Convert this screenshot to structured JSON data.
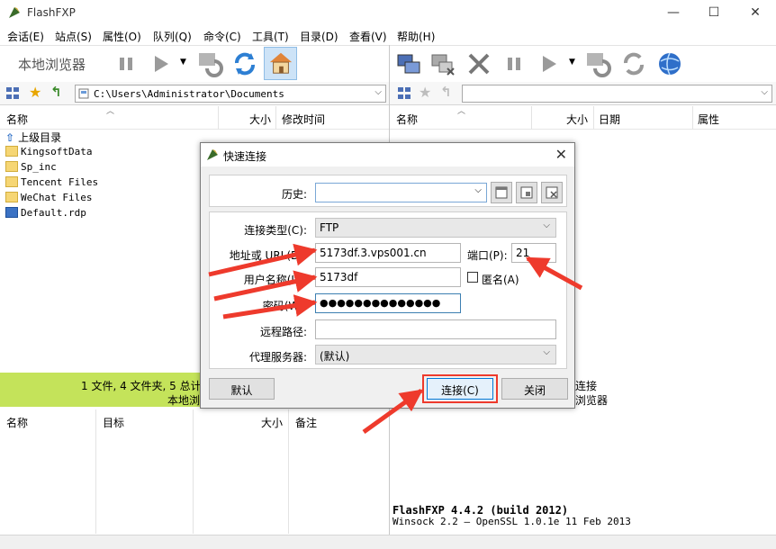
{
  "window": {
    "title": "FlashFXP"
  },
  "menu": [
    "会话(E)",
    "站点(S)",
    "属性(O)",
    "队列(Q)",
    "命令(C)",
    "工具(T)",
    "目录(D)",
    "查看(V)",
    "帮助(H)"
  ],
  "toolbar_left": {
    "label": "本地浏览器"
  },
  "local": {
    "path": "C:\\Users\\Administrator\\Documents",
    "columns": [
      "名称",
      "大小",
      "修改时间"
    ],
    "items": [
      {
        "name": "上级目录",
        "icon": "up-arrow-icon"
      },
      {
        "name": "KingsoftData",
        "icon": "folder-icon"
      },
      {
        "name": "Sp_inc",
        "icon": "folder-icon"
      },
      {
        "name": "Tencent Files",
        "icon": "folder-icon"
      },
      {
        "name": "WeChat Files",
        "icon": "folder-icon"
      },
      {
        "name": "Default.rdp",
        "icon": "rdp-file-icon"
      }
    ],
    "status_line1": "1 文件, 4 文件夹, 5 总计",
    "status_line2": "本地浏"
  },
  "remote": {
    "path": "",
    "columns": [
      "名称",
      "大小",
      "日期",
      "属性"
    ],
    "status_line1": "连接",
    "status_line2": "浏览器"
  },
  "queue": {
    "columns": [
      "名称",
      "目标",
      "大小",
      "备注"
    ]
  },
  "log": {
    "line1": "FlashFXP 4.4.2 (build 2012)",
    "line2": "Winsock 2.2 — OpenSSL 1.0.1e 11 Feb 2013"
  },
  "dialog": {
    "title": "快速连接",
    "history_label": "历史:",
    "history_value": "",
    "type_label": "连接类型(C):",
    "type_value": "FTP",
    "address_label": "地址或 URL(D):",
    "address_value": "5173df.3.vps001.cn",
    "port_label": "端口(P):",
    "port_value": "21",
    "user_label": "用户名称(U):",
    "user_value": "5173df",
    "anon_label": "匿名(A)",
    "password_label": "密码(W):",
    "password_value": "●●●●●●●●●●●●●●",
    "remote_path_label": "远程路径:",
    "remote_path_value": "",
    "proxy_label": "代理服务器:",
    "proxy_value": "(默认)",
    "default_button": "默认",
    "connect_button": "连接(C)",
    "close_button": "关闭"
  },
  "colors": {
    "status_green": "#c4e35a",
    "annotation_red": "#ee3a2c",
    "field_focus": "#3c7fb1"
  }
}
